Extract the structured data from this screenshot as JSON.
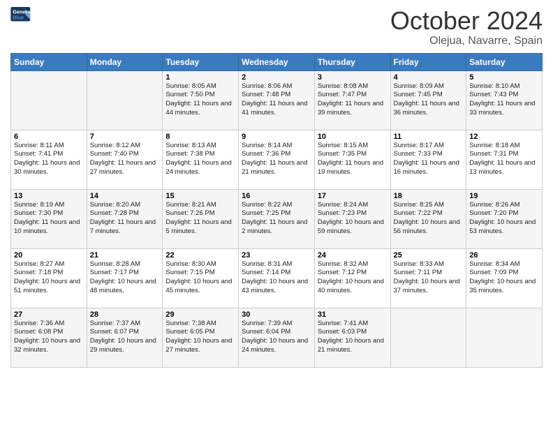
{
  "logo": {
    "line1": "General",
    "line2": "Blue"
  },
  "title": "October 2024",
  "location": "Olejua, Navarre, Spain",
  "days_of_week": [
    "Sunday",
    "Monday",
    "Tuesday",
    "Wednesday",
    "Thursday",
    "Friday",
    "Saturday"
  ],
  "weeks": [
    [
      {
        "day": "",
        "info": ""
      },
      {
        "day": "",
        "info": ""
      },
      {
        "day": "1",
        "info": "Sunrise: 8:05 AM\nSunset: 7:50 PM\nDaylight: 11 hours and 44 minutes."
      },
      {
        "day": "2",
        "info": "Sunrise: 8:06 AM\nSunset: 7:48 PM\nDaylight: 11 hours and 41 minutes."
      },
      {
        "day": "3",
        "info": "Sunrise: 8:08 AM\nSunset: 7:47 PM\nDaylight: 11 hours and 39 minutes."
      },
      {
        "day": "4",
        "info": "Sunrise: 8:09 AM\nSunset: 7:45 PM\nDaylight: 11 hours and 36 minutes."
      },
      {
        "day": "5",
        "info": "Sunrise: 8:10 AM\nSunset: 7:43 PM\nDaylight: 11 hours and 33 minutes."
      }
    ],
    [
      {
        "day": "6",
        "info": "Sunrise: 8:11 AM\nSunset: 7:41 PM\nDaylight: 11 hours and 30 minutes."
      },
      {
        "day": "7",
        "info": "Sunrise: 8:12 AM\nSunset: 7:40 PM\nDaylight: 11 hours and 27 minutes."
      },
      {
        "day": "8",
        "info": "Sunrise: 8:13 AM\nSunset: 7:38 PM\nDaylight: 11 hours and 24 minutes."
      },
      {
        "day": "9",
        "info": "Sunrise: 8:14 AM\nSunset: 7:36 PM\nDaylight: 11 hours and 21 minutes."
      },
      {
        "day": "10",
        "info": "Sunrise: 8:15 AM\nSunset: 7:35 PM\nDaylight: 11 hours and 19 minutes."
      },
      {
        "day": "11",
        "info": "Sunrise: 8:17 AM\nSunset: 7:33 PM\nDaylight: 11 hours and 16 minutes."
      },
      {
        "day": "12",
        "info": "Sunrise: 8:18 AM\nSunset: 7:31 PM\nDaylight: 11 hours and 13 minutes."
      }
    ],
    [
      {
        "day": "13",
        "info": "Sunrise: 8:19 AM\nSunset: 7:30 PM\nDaylight: 11 hours and 10 minutes."
      },
      {
        "day": "14",
        "info": "Sunrise: 8:20 AM\nSunset: 7:28 PM\nDaylight: 11 hours and 7 minutes."
      },
      {
        "day": "15",
        "info": "Sunrise: 8:21 AM\nSunset: 7:26 PM\nDaylight: 11 hours and 5 minutes."
      },
      {
        "day": "16",
        "info": "Sunrise: 8:22 AM\nSunset: 7:25 PM\nDaylight: 11 hours and 2 minutes."
      },
      {
        "day": "17",
        "info": "Sunrise: 8:24 AM\nSunset: 7:23 PM\nDaylight: 10 hours and 59 minutes."
      },
      {
        "day": "18",
        "info": "Sunrise: 8:25 AM\nSunset: 7:22 PM\nDaylight: 10 hours and 56 minutes."
      },
      {
        "day": "19",
        "info": "Sunrise: 8:26 AM\nSunset: 7:20 PM\nDaylight: 10 hours and 53 minutes."
      }
    ],
    [
      {
        "day": "20",
        "info": "Sunrise: 8:27 AM\nSunset: 7:18 PM\nDaylight: 10 hours and 51 minutes."
      },
      {
        "day": "21",
        "info": "Sunrise: 8:28 AM\nSunset: 7:17 PM\nDaylight: 10 hours and 48 minutes."
      },
      {
        "day": "22",
        "info": "Sunrise: 8:30 AM\nSunset: 7:15 PM\nDaylight: 10 hours and 45 minutes."
      },
      {
        "day": "23",
        "info": "Sunrise: 8:31 AM\nSunset: 7:14 PM\nDaylight: 10 hours and 43 minutes."
      },
      {
        "day": "24",
        "info": "Sunrise: 8:32 AM\nSunset: 7:12 PM\nDaylight: 10 hours and 40 minutes."
      },
      {
        "day": "25",
        "info": "Sunrise: 8:33 AM\nSunset: 7:11 PM\nDaylight: 10 hours and 37 minutes."
      },
      {
        "day": "26",
        "info": "Sunrise: 8:34 AM\nSunset: 7:09 PM\nDaylight: 10 hours and 35 minutes."
      }
    ],
    [
      {
        "day": "27",
        "info": "Sunrise: 7:36 AM\nSunset: 6:08 PM\nDaylight: 10 hours and 32 minutes."
      },
      {
        "day": "28",
        "info": "Sunrise: 7:37 AM\nSunset: 6:07 PM\nDaylight: 10 hours and 29 minutes."
      },
      {
        "day": "29",
        "info": "Sunrise: 7:38 AM\nSunset: 6:05 PM\nDaylight: 10 hours and 27 minutes."
      },
      {
        "day": "30",
        "info": "Sunrise: 7:39 AM\nSunset: 6:04 PM\nDaylight: 10 hours and 24 minutes."
      },
      {
        "day": "31",
        "info": "Sunrise: 7:41 AM\nSunset: 6:03 PM\nDaylight: 10 hours and 21 minutes."
      },
      {
        "day": "",
        "info": ""
      },
      {
        "day": "",
        "info": ""
      }
    ]
  ]
}
